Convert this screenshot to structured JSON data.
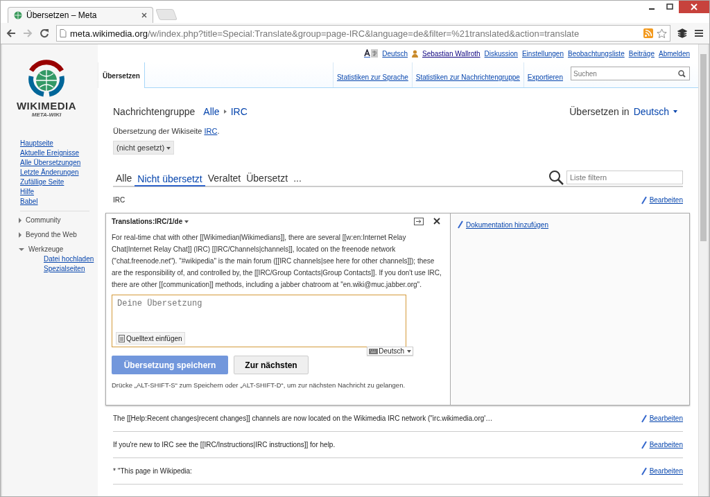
{
  "browser": {
    "tab_title": "Übersetzen – Meta",
    "url_host": "meta.wikimedia.org",
    "url_path": "/w/index.php?title=Special:Translate&group=page-IRC&language=de&filter=%21translated&action=translate"
  },
  "personal_tools": {
    "language": "Deutsch",
    "links": [
      {
        "label": "Sebastian Wallroth",
        "kind": "user"
      },
      {
        "label": "Diskussion",
        "kind": "link"
      },
      {
        "label": "Einstellungen",
        "kind": "link"
      },
      {
        "label": "Beobachtungsliste",
        "kind": "link"
      },
      {
        "label": "Beiträge",
        "kind": "link"
      },
      {
        "label": "Abmelden",
        "kind": "link"
      }
    ]
  },
  "logo": {
    "name": "WIKIMEDIA",
    "subtitle": "META-WIKI"
  },
  "sidebar": {
    "navigation": [
      "Hauptseite",
      "Aktuelle Ereignisse",
      "Alle Übersetzungen",
      "Letzte Änderungen",
      "Zufällige Seite",
      "Hilfe",
      "Babel"
    ],
    "portals": [
      {
        "label": "Community",
        "expanded": false
      },
      {
        "label": "Beyond the Web",
        "expanded": false
      },
      {
        "label": "Werkzeuge",
        "expanded": true,
        "children": [
          "Datei hochladen",
          "Spezialseiten"
        ]
      }
    ]
  },
  "page_tabs": [
    {
      "label": "Übersetzen",
      "selected": true
    }
  ],
  "actions": [
    "Statistiken zur Sprache",
    "Statistiken zur Nachrichtengruppe",
    "Exportieren"
  ],
  "search": {
    "placeholder": "Suchen"
  },
  "header": {
    "group_label": "Nachrichtengruppe",
    "breadcrumb": [
      "Alle",
      "IRC"
    ],
    "translate_in": "Übersetzen in",
    "language": "Deutsch"
  },
  "description": {
    "before": "Übersetzung der Wikiseite ",
    "link": "IRC",
    "after": "."
  },
  "priority": "(nicht gesetzt)",
  "filter_tabs": [
    {
      "label": "Alle",
      "selected": false
    },
    {
      "label": "Nicht übersetzt",
      "selected": true
    },
    {
      "label": "Veraltet",
      "selected": false
    },
    {
      "label": "Übersetzt",
      "selected": false
    },
    {
      "label": "...",
      "selected": false
    }
  ],
  "filter": {
    "placeholder": "Liste filtern"
  },
  "messages": [
    {
      "kind": "row",
      "text": "IRC",
      "edit": "Bearbeiten"
    },
    {
      "kind": "editor",
      "title": "Translations:IRC/1/de",
      "source": "For real-time chat with other [[Wikimedian|Wikimedians]], there are several [[w:en:Internet Relay Chat|Internet Relay Chat]] (IRC) [[IRC/Channels|channels]], located on the freenode network (\"chat.freenode.net\"). \"#wikipedia\" is the main forum ([[IRC channels|see here for other channels]]); these are the responsibility of, and controlled by, the [[IRC/Group Contacts|Group Contacts]]. If you don't use IRC, there are other [[communication]] methods, including a jabber chatroom at \"en.wiki@muc.jabber.org\".",
      "placeholder": "Deine Übersetzung",
      "paste": "Quelltext einfügen",
      "input_language": "Deutsch",
      "save": {
        "label": "Übersetzung speichern",
        "disabled": true
      },
      "next": "Zur nächsten",
      "hint": "Drücke „ALT-SHIFT-S“ zum Speichern oder „ALT-SHIFT-D“, um zur nächsten Nachricht zu gelangen.",
      "doc_link": "Dokumentation hinzufügen"
    },
    {
      "kind": "row",
      "text": "The [[Help:Recent changes|recent changes]] channels are now located on the Wikimedia IRC network (\"irc.wikimedia.org'…",
      "edit": "Bearbeiten"
    },
    {
      "kind": "row",
      "text": "If you're new to IRC see the [[IRC/Instructions|IRC instructions]] for help.",
      "edit": "Bearbeiten"
    },
    {
      "kind": "row",
      "text": "* ''This page in Wikipedia:",
      "edit": "Bearbeiten"
    }
  ]
}
